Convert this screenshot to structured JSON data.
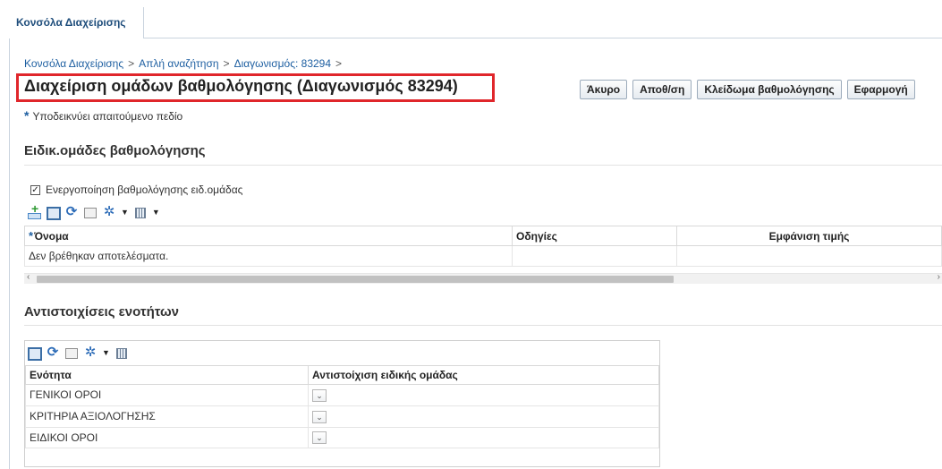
{
  "tab": {
    "label": "Κονσόλα Διαχείρισης"
  },
  "breadcrumb": {
    "items": [
      "Κονσόλα Διαχείρισης",
      "Απλή αναζήτηση",
      "Διαγωνισμός: 83294"
    ],
    "separator": ">"
  },
  "page": {
    "title": "Διαχείριση ομάδων βαθμολόγησης (Διαγωνισμός 83294)"
  },
  "buttons": {
    "cancel": "Άκυρο",
    "save": "Αποθ/ση",
    "lock": "Κλείδωμα βαθμολόγησης",
    "apply": "Εφαρμογή"
  },
  "required_note": {
    "star": "*",
    "text": "Υποδεικνύει απαιτούμενο πεδίο"
  },
  "section1": {
    "title": "Ειδικ.ομάδες βαθμολόγησης",
    "checkbox_label": "Ενεργοποίηση βαθμολόγησης ειδ.ομάδας",
    "checkbox_checked": true,
    "columns": [
      "Όνομα",
      "Οδηγίες",
      "Εμφάνιση τιμής"
    ],
    "empty_message": "Δεν βρέθηκαν αποτελέσματα."
  },
  "section2": {
    "title": "Αντιστοιχίσεις ενοτήτων",
    "columns": [
      "Ενότητα",
      "Αντιστοίχιση ειδικής ομάδας"
    ],
    "rows": [
      {
        "section": "ΓΕΝΙΚΟΙ ΟΡΟΙ",
        "group": ""
      },
      {
        "section": "ΚΡΙΤΗΡΙΑ ΑΞΙΟΛΟΓΗΣΗΣ",
        "group": ""
      },
      {
        "section": "ΕΙΔΙΚΟΙ ΟΡΟΙ",
        "group": ""
      }
    ]
  },
  "colors": {
    "link": "#1e5fa1",
    "highlight": "#e0262b"
  }
}
